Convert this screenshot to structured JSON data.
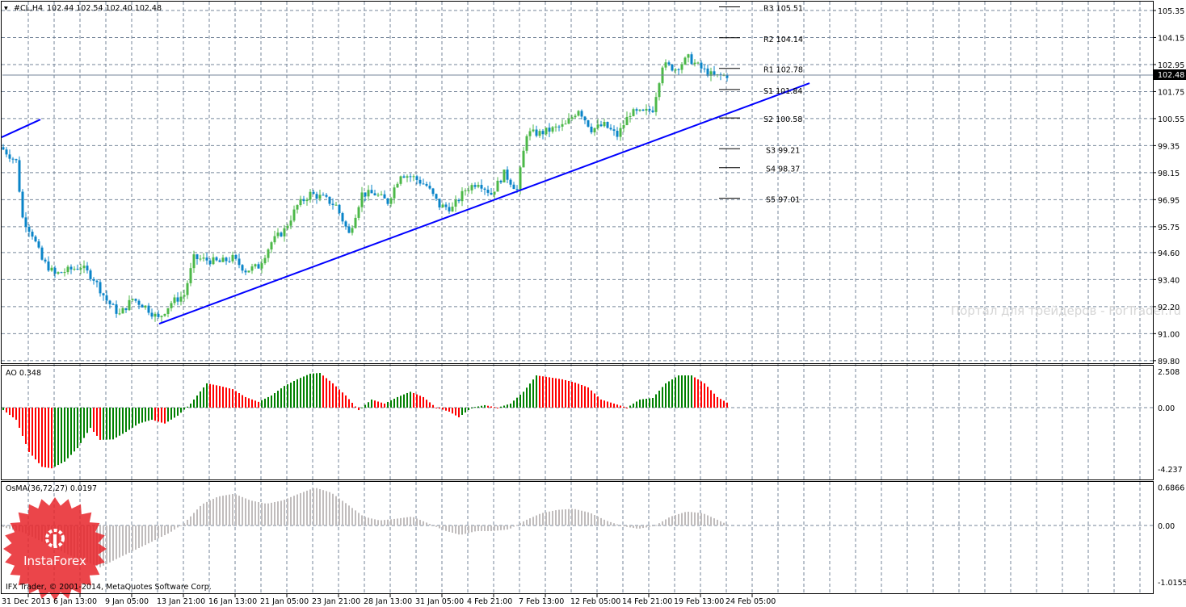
{
  "header": {
    "symbol": "#CL,H4",
    "ohlc": "102.44 102.54 102.40 102.48"
  },
  "indicators": {
    "ao_label": "AO 0.348",
    "osma_label": "OsMA(36,72,27) 0.0197"
  },
  "current_price": "102.48",
  "copyright": "IFX Trader, © 2001-2014, MetaQuotes Software Corp.",
  "watermark": "Портал для трейдеров - ForTrader.ru",
  "logo_text": "InstaForex",
  "colors": {
    "up": "#4cb848",
    "down": "#0a84c8",
    "ao_up": "#008000",
    "ao_down": "#ff0000",
    "osma": "#c0bcbc",
    "trendline": "#0000ff",
    "grid": "#76869a"
  },
  "chart_data": [
    {
      "type": "candlestick",
      "title": "#CL,H4",
      "x_unit": "bar index (H4)",
      "time_labels": [
        "31 Dec 2013",
        "6 Jan 13:00",
        "9 Jan 05:00",
        "13 Jan 21:00",
        "16 Jan 13:00",
        "21 Jan 05:00",
        "23 Jan 21:00",
        "28 Jan 13:00",
        "31 Jan 05:00",
        "4 Feb 21:00",
        "7 Feb 13:00",
        "12 Feb 05:00",
        "14 Feb 21:00",
        "19 Feb 13:00",
        "24 Feb 05:00"
      ],
      "y_ticks": [
        "105.35",
        "104.15",
        "102.95",
        "101.75",
        "100.55",
        "99.35",
        "98.15",
        "96.95",
        "95.75",
        "94.60",
        "93.40",
        "92.20",
        "91.00",
        "89.80"
      ],
      "ylim": [
        89.7,
        105.8
      ],
      "close_keyframes": [
        [
          0,
          99.18
        ],
        [
          4,
          98.65
        ],
        [
          6,
          96.14
        ],
        [
          9,
          95.42
        ],
        [
          12,
          94.27
        ],
        [
          16,
          93.63
        ],
        [
          20,
          93.81
        ],
        [
          24,
          93.99
        ],
        [
          28,
          93.45
        ],
        [
          32,
          92.48
        ],
        [
          36,
          91.84
        ],
        [
          40,
          92.55
        ],
        [
          44,
          92.2
        ],
        [
          48,
          91.66
        ],
        [
          52,
          92.38
        ],
        [
          56,
          92.73
        ],
        [
          59,
          94.35
        ],
        [
          63,
          94.27
        ],
        [
          67,
          94.17
        ],
        [
          71,
          94.35
        ],
        [
          75,
          93.81
        ],
        [
          79,
          93.99
        ],
        [
          83,
          95.06
        ],
        [
          87,
          95.6
        ],
        [
          91,
          96.68
        ],
        [
          95,
          97.21
        ],
        [
          99,
          97.03
        ],
        [
          103,
          96.68
        ],
        [
          107,
          95.42
        ],
        [
          111,
          97.21
        ],
        [
          115,
          97.21
        ],
        [
          119,
          96.85
        ],
        [
          123,
          98.11
        ],
        [
          127,
          97.93
        ],
        [
          131,
          97.57
        ],
        [
          135,
          96.68
        ],
        [
          139,
          96.57
        ],
        [
          143,
          97.39
        ],
        [
          147,
          97.75
        ],
        [
          151,
          97.21
        ],
        [
          155,
          98.11
        ],
        [
          159,
          97.39
        ],
        [
          162,
          99.9
        ],
        [
          166,
          99.9
        ],
        [
          170,
          100.08
        ],
        [
          174,
          100.26
        ],
        [
          178,
          100.98
        ],
        [
          182,
          100.08
        ],
        [
          186,
          100.26
        ],
        [
          190,
          99.79
        ],
        [
          194,
          100.8
        ],
        [
          198,
          100.8
        ],
        [
          201,
          100.98
        ],
        [
          204,
          102.95
        ],
        [
          208,
          102.77
        ],
        [
          212,
          103.24
        ],
        [
          216,
          102.77
        ],
        [
          220,
          102.41
        ],
        [
          224,
          102.48
        ]
      ],
      "trendlines": [
        [
          [
            48.25,
            91.44
          ],
          [
            249.5,
            102.12
          ]
        ],
        [
          [
            -0.5,
            99.72
          ],
          [
            11.5,
            100.51
          ]
        ]
      ],
      "pivots": [
        {
          "name": "R3",
          "value": "105.51"
        },
        {
          "name": "R2",
          "value": "104.14"
        },
        {
          "name": "R1",
          "value": "102.78"
        },
        {
          "name": "S1",
          "value": "101.84"
        },
        {
          "name": "S2",
          "value": "100.58"
        },
        {
          "name": "S3",
          "value": "99.21"
        },
        {
          "name": "S4",
          "value": "98.37"
        },
        {
          "name": "S5",
          "value": "97.01"
        }
      ]
    },
    {
      "type": "bar",
      "title": "AO",
      "y_ticks": [
        "2.508",
        "0.00",
        "-4.237"
      ],
      "ylim": [
        -4.6,
        2.6
      ],
      "keyframes": [
        [
          0,
          -0.17
        ],
        [
          4,
          -0.84
        ],
        [
          8,
          -3.07
        ],
        [
          12,
          -4.1
        ],
        [
          15,
          -4.2
        ],
        [
          19,
          -3.74
        ],
        [
          23,
          -2.8
        ],
        [
          27,
          -1.4
        ],
        [
          30,
          -2.23
        ],
        [
          34,
          -2.2
        ],
        [
          38,
          -1.68
        ],
        [
          42,
          -1.1
        ],
        [
          46,
          -0.84
        ],
        [
          50,
          -1.1
        ],
        [
          54,
          -0.56
        ],
        [
          58,
          0.28
        ],
        [
          63,
          1.68
        ],
        [
          67,
          1.5
        ],
        [
          71,
          1.28
        ],
        [
          75,
          0.73
        ],
        [
          79,
          0.4
        ],
        [
          83,
          0.84
        ],
        [
          87,
          1.5
        ],
        [
          91,
          1.96
        ],
        [
          95,
          2.35
        ],
        [
          98,
          2.4
        ],
        [
          102,
          1.68
        ],
        [
          106,
          0.84
        ],
        [
          110,
          -0.17
        ],
        [
          114,
          0.56
        ],
        [
          118,
          0.28
        ],
        [
          122,
          0.73
        ],
        [
          126,
          1.1
        ],
        [
          130,
          0.73
        ],
        [
          134,
          0.0
        ],
        [
          138,
          -0.28
        ],
        [
          141,
          -0.67
        ],
        [
          145,
          0.0
        ],
        [
          149,
          0.17
        ],
        [
          153,
          0.0
        ],
        [
          157,
          0.28
        ],
        [
          161,
          1.1
        ],
        [
          165,
          2.23
        ],
        [
          169,
          2.1
        ],
        [
          173,
          1.96
        ],
        [
          177,
          1.73
        ],
        [
          181,
          1.4
        ],
        [
          185,
          0.56
        ],
        [
          189,
          0.28
        ],
        [
          193,
          0.0
        ],
        [
          197,
          0.56
        ],
        [
          201,
          0.67
        ],
        [
          205,
          1.68
        ],
        [
          209,
          2.23
        ],
        [
          213,
          2.23
        ],
        [
          217,
          1.68
        ],
        [
          221,
          0.73
        ],
        [
          224,
          0.348
        ]
      ]
    },
    {
      "type": "bar",
      "title": "OsMA(36,72,27)",
      "y_ticks": [
        "0.6866",
        "0.00",
        "-1.0155"
      ],
      "ylim": [
        -1.1,
        0.75
      ],
      "keyframes": [
        [
          0,
          -0.03
        ],
        [
          6.5,
          -0.13
        ],
        [
          14,
          -0.35
        ],
        [
          21.5,
          -0.56
        ],
        [
          30,
          -0.75
        ],
        [
          36.5,
          -0.56
        ],
        [
          44,
          -0.35
        ],
        [
          51.5,
          -0.13
        ],
        [
          56,
          0.04
        ],
        [
          61.5,
          0.38
        ],
        [
          66.5,
          0.52
        ],
        [
          71.5,
          0.57
        ],
        [
          76.5,
          0.45
        ],
        [
          81.5,
          0.39
        ],
        [
          86.5,
          0.45
        ],
        [
          91.5,
          0.57
        ],
        [
          96.5,
          0.68
        ],
        [
          101.5,
          0.59
        ],
        [
          106.5,
          0.38
        ],
        [
          111.5,
          0.16
        ],
        [
          116.5,
          0.09
        ],
        [
          121.5,
          0.12
        ],
        [
          126.5,
          0.16
        ],
        [
          131.5,
          0.04
        ],
        [
          136.5,
          -0.09
        ],
        [
          141.5,
          -0.17
        ],
        [
          146.5,
          -0.1
        ],
        [
          151.5,
          -0.1
        ],
        [
          156.5,
          -0.07
        ],
        [
          161.5,
          0.09
        ],
        [
          166.5,
          0.22
        ],
        [
          171.5,
          0.28
        ],
        [
          176.5,
          0.3
        ],
        [
          181.5,
          0.23
        ],
        [
          186.5,
          0.09
        ],
        [
          191.5,
          -0.01
        ],
        [
          196.5,
          -0.06
        ],
        [
          201.5,
          -0.01
        ],
        [
          206.5,
          0.16
        ],
        [
          211.5,
          0.25
        ],
        [
          216.5,
          0.22
        ],
        [
          221.5,
          0.09
        ],
        [
          224,
          0.0197
        ]
      ]
    }
  ]
}
